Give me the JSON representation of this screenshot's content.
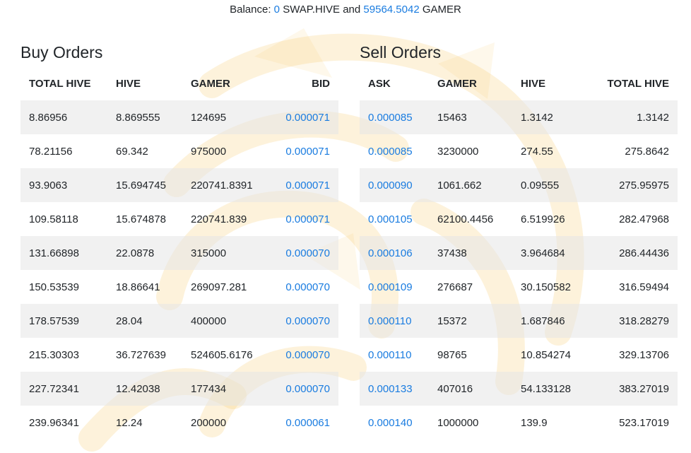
{
  "balance": {
    "prefix": "Balance:",
    "swap_hive": "0",
    "swap_hive_unit": "SWAP.HIVE",
    "joiner": "and",
    "gamer": "59564.5042",
    "gamer_unit": "GAMER"
  },
  "buy_orders": {
    "title": "Buy Orders",
    "headers": [
      "TOTAL HIVE",
      "HIVE",
      "GAMER",
      "BID"
    ],
    "rows": [
      [
        "8.86956",
        "8.869555",
        "124695",
        "0.000071"
      ],
      [
        "78.21156",
        "69.342",
        "975000",
        "0.000071"
      ],
      [
        "93.9063",
        "15.694745",
        "220741.8391",
        "0.000071"
      ],
      [
        "109.58118",
        "15.674878",
        "220741.839",
        "0.000071"
      ],
      [
        "131.66898",
        "22.0878",
        "315000",
        "0.000070"
      ],
      [
        "150.53539",
        "18.86641",
        "269097.281",
        "0.000070"
      ],
      [
        "178.57539",
        "28.04",
        "400000",
        "0.000070"
      ],
      [
        "215.30303",
        "36.727639",
        "524605.6176",
        "0.000070"
      ],
      [
        "227.72341",
        "12.42038",
        "177434",
        "0.000070"
      ],
      [
        "239.96341",
        "12.24",
        "200000",
        "0.000061"
      ]
    ]
  },
  "sell_orders": {
    "title": "Sell Orders",
    "headers": [
      "ASK",
      "GAMER",
      "HIVE",
      "TOTAL HIVE"
    ],
    "rows": [
      [
        "0.000085",
        "15463",
        "1.3142",
        "1.3142"
      ],
      [
        "0.000085",
        "3230000",
        "274.55",
        "275.8642"
      ],
      [
        "0.000090",
        "1061.662",
        "0.09555",
        "275.95975"
      ],
      [
        "0.000105",
        "62100.4456",
        "6.519926",
        "282.47968"
      ],
      [
        "0.000106",
        "37438",
        "3.964684",
        "286.44436"
      ],
      [
        "0.000109",
        "276687",
        "30.150582",
        "316.59494"
      ],
      [
        "0.000110",
        "15372",
        "1.687846",
        "318.28279"
      ],
      [
        "0.000110",
        "98765",
        "10.854274",
        "329.13706"
      ],
      [
        "0.000133",
        "407016",
        "54.133128",
        "383.27019"
      ],
      [
        "0.000140",
        "1000000",
        "139.9",
        "523.17019"
      ]
    ]
  },
  "colors": {
    "link": "#1a7ce0",
    "stripe": "#f2f2f2",
    "watermark": "#f6c25a"
  },
  "icons": {
    "background": "gamer-logo-watermark"
  }
}
